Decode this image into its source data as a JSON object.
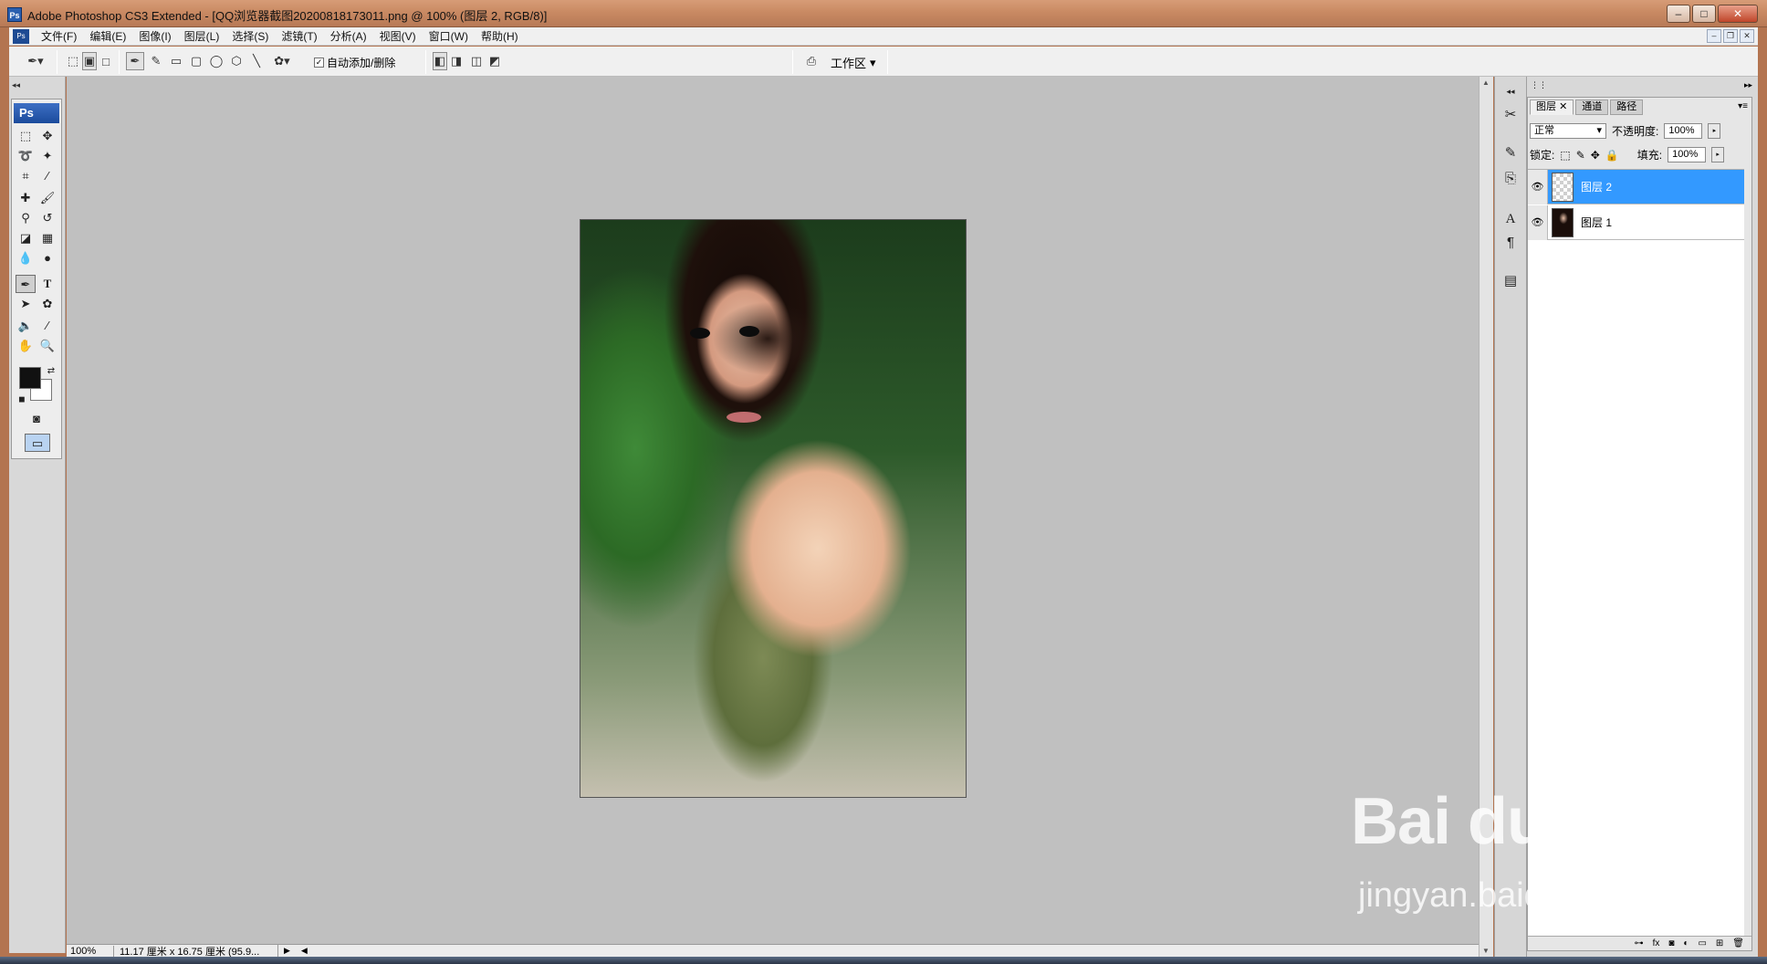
{
  "window": {
    "title": "Adobe Photoshop CS3 Extended - [QQ浏览器截图20200818173011.png @ 100% (图层 2, RGB/8)]",
    "logo": "Ps",
    "minimize": "–",
    "maximize": "□",
    "close": "✕"
  },
  "menu": {
    "doc_icon": "Ps",
    "items": [
      "文件(F)",
      "编辑(E)",
      "图像(I)",
      "图层(L)",
      "选择(S)",
      "滤镜(T)",
      "分析(A)",
      "视图(V)",
      "窗口(W)",
      "帮助(H)"
    ]
  },
  "options_bar": {
    "auto_add_delete_label": "自动添加/删除",
    "auto_add_checked": true,
    "workspace_label": "工作区"
  },
  "toolbox": {
    "badge": "Ps",
    "foreground_color": "#111111",
    "background_color": "#ffffff"
  },
  "document": {
    "zoom": "100%",
    "info": "11.17 厘米 x 16.75 厘米 (95.9..."
  },
  "layers_panel": {
    "tabs": [
      "图层",
      "通道",
      "路径"
    ],
    "blend_mode": "正常",
    "opacity_label": "不透明度:",
    "opacity_value": "100%",
    "lock_label": "锁定:",
    "fill_label": "填充:",
    "fill_value": "100%",
    "layers": [
      {
        "name": "图层 2",
        "selected": true,
        "visible": true
      },
      {
        "name": "图层 1",
        "selected": false,
        "visible": true
      }
    ]
  },
  "watermark": {
    "brand": "Bai du 经验",
    "url": "jingyan.baidu.com"
  }
}
